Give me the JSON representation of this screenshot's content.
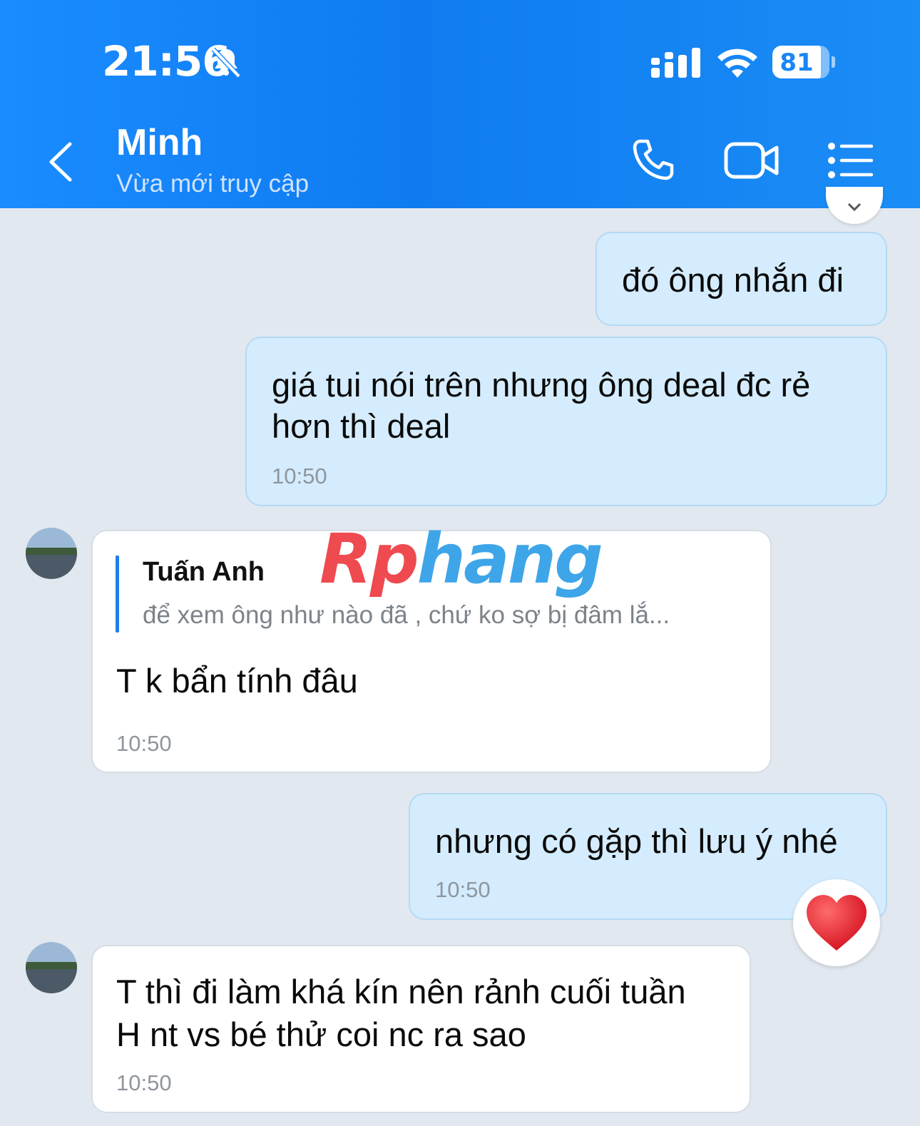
{
  "status_bar": {
    "time": "21:56",
    "battery": "81"
  },
  "header": {
    "contact_name": "Minh",
    "status": "Vừa mới truy cập"
  },
  "watermark": {
    "part1": "Rp",
    "part2": "hang"
  },
  "messages": [
    {
      "side": "mine",
      "text": "đó ông nhắn đi"
    },
    {
      "side": "mine",
      "line1": "giá tui nói trên nhưng ông deal đc rẻ",
      "line2": "hơn thì deal",
      "time": "10:50"
    },
    {
      "side": "theirs",
      "reply_author": "Tuấn Anh",
      "reply_preview": "để xem ông như nào đã , chứ ko sợ bị đâm lắ...",
      "text": "T k bẩn tính đâu",
      "time": "10:50"
    },
    {
      "side": "mine",
      "text": "nhưng có gặp thì lưu ý nhé",
      "time": "10:50",
      "reaction": "heart"
    },
    {
      "side": "theirs",
      "line1": "T thì đi làm khá kín nên rảnh cuối tuần",
      "line2": "H nt vs bé thử coi nc ra sao",
      "time": "10:50"
    }
  ],
  "colors": {
    "header_blue": "#0f7bf0",
    "mine_bubble": "#d4ecfd",
    "theirs_bubble": "#ffffff",
    "background": "#e2e8ef",
    "reply_bar": "#1e7fe6"
  }
}
